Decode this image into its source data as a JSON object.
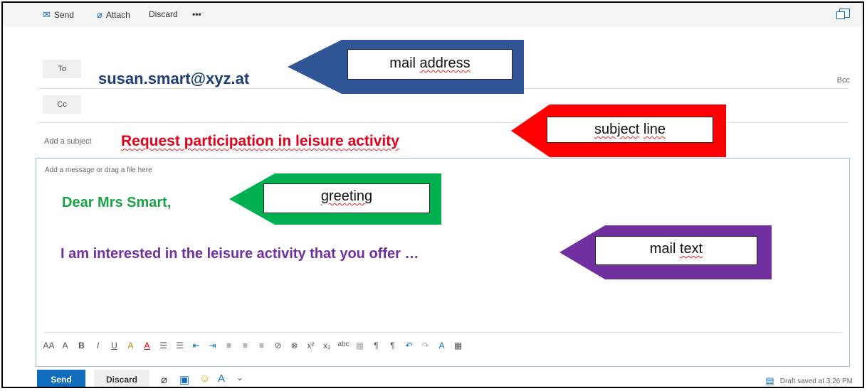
{
  "toolbar": {
    "send_label": "Send",
    "attach_label": "Attach",
    "discard_label": "Discard",
    "more_label": "•••",
    "icons": [
      "send-mail-icon",
      "paperclip-icon",
      "popout-icon"
    ]
  },
  "to": {
    "label": "To",
    "value": "susan.smart@xyz.at",
    "bcc_label": "Bcc"
  },
  "cc": {
    "label": "Cc"
  },
  "subject": {
    "placeholder": "Add a subject",
    "value": "Request participation in leisure activity"
  },
  "body": {
    "placeholder": "Add a message or drag a file here",
    "greeting": "Dear Mrs Smart,",
    "text": "I am interested in the leisure activity that you offer …"
  },
  "callouts": {
    "mail_address": {
      "word1": "mail",
      "word2": "address",
      "color": "#2f5597"
    },
    "subject_line": {
      "word1": "subject",
      "word2": "line",
      "color": "#ff0000"
    },
    "greeting": {
      "word1": "greeting",
      "color": "#00b050"
    },
    "mail_text": {
      "word1": "mail",
      "word2": "text",
      "color": "#7030a0"
    }
  },
  "format_toolbar": {
    "items": [
      "AA",
      "A",
      "B",
      "I",
      "U",
      "A",
      "A",
      "☰",
      "☰",
      "⇤",
      "⇥",
      "≡",
      "≡",
      "≡",
      "⊘",
      "⊗",
      "x²",
      "x₂",
      "abc",
      "▦",
      "¶",
      "¶",
      "↶",
      "↷",
      "A",
      "▦"
    ]
  },
  "bottom": {
    "send_label": "Send",
    "discard_label": "Discard",
    "draft_status": "Draft saved at 3:26 PM"
  },
  "colors": {
    "accent": "#0f6cbd",
    "to_text": "#1f3c7a",
    "subject_text": "#e3001b",
    "greeting_text": "#1aa344",
    "mail_text": "#7030a0"
  }
}
